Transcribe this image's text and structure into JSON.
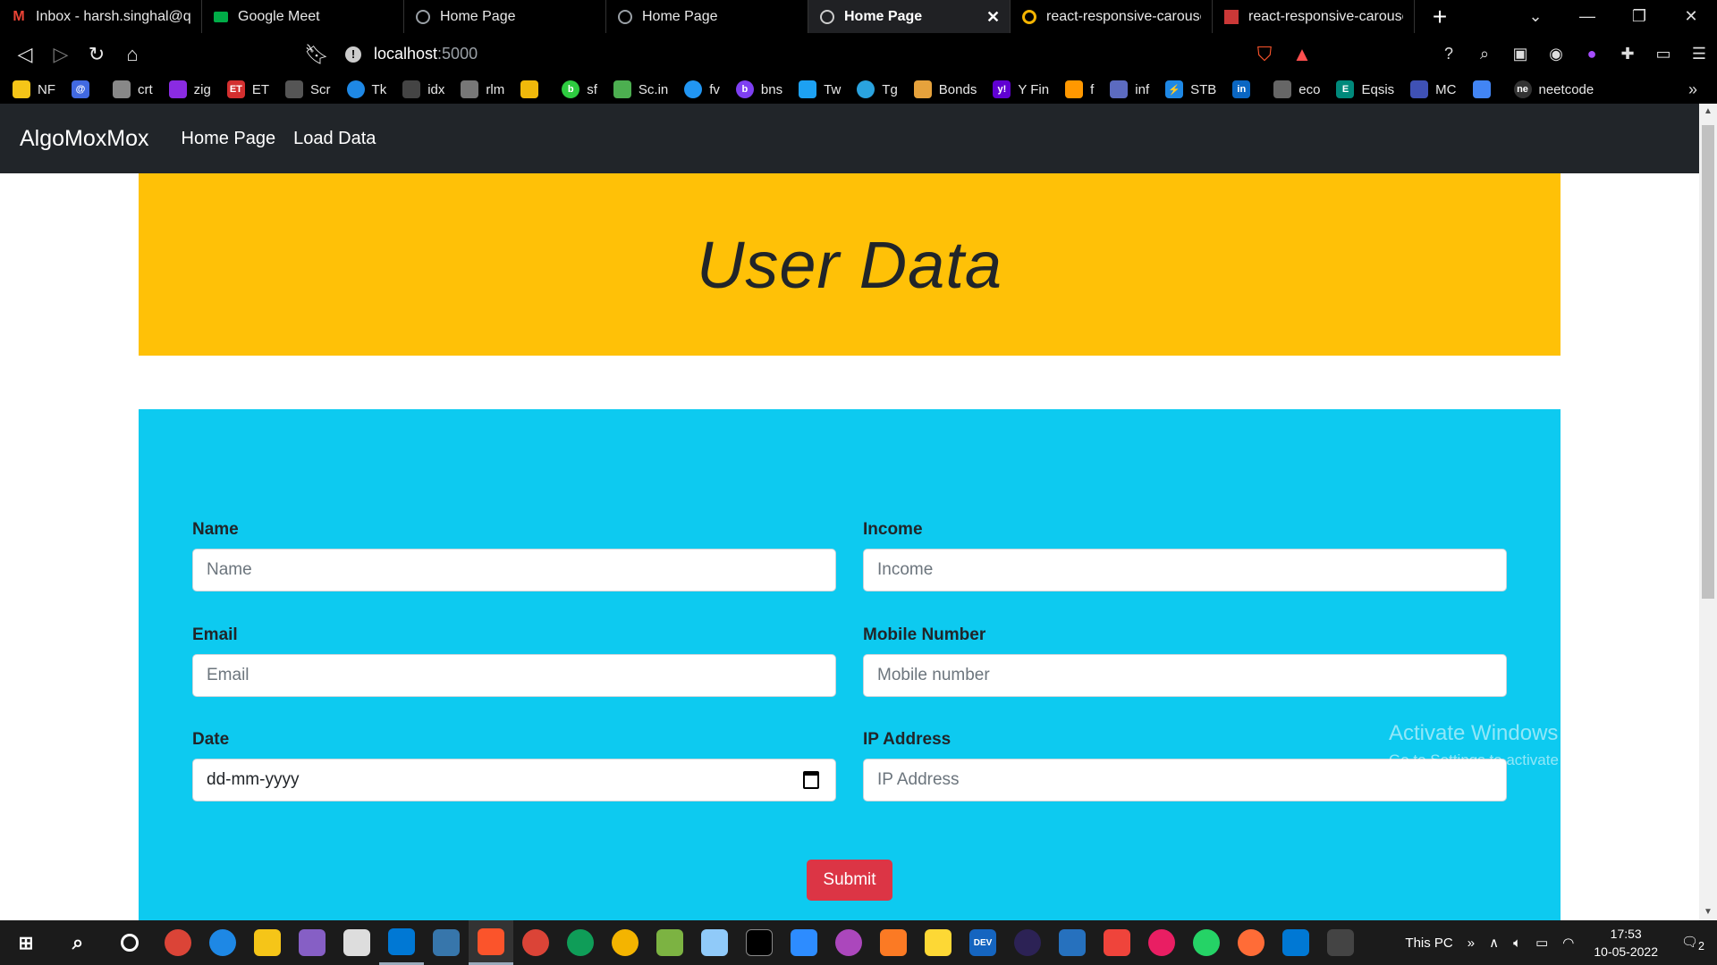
{
  "tabs": [
    {
      "label": "Inbox - harsh.singhal@qua",
      "icon": "gmail-icon",
      "color": "#ea4335",
      "active": false
    },
    {
      "label": "Google Meet",
      "icon": "meet-icon",
      "color": "#00ac47",
      "active": false
    },
    {
      "label": "Home Page",
      "icon": "globe-icon",
      "color": "#9aa0a6",
      "active": false
    },
    {
      "label": "Home Page",
      "icon": "globe-icon",
      "color": "#9aa0a6",
      "active": false
    },
    {
      "label": "Home Page",
      "icon": "globe-icon",
      "color": "#9aa0a6",
      "active": true
    },
    {
      "label": "react-responsive-carousel,",
      "icon": "ring-icon",
      "color": "#f4b400",
      "active": false
    },
    {
      "label": "react-responsive-carousel -",
      "icon": "npm-icon",
      "color": "#cb3837",
      "active": false
    }
  ],
  "address": {
    "host": "localhost",
    "port": ":5000"
  },
  "bookmarks": [
    {
      "label": "NF",
      "color": "#f5c518"
    },
    {
      "label": "",
      "color": "#4169e1"
    },
    {
      "label": "crt",
      "color": "#888888"
    },
    {
      "label": "zig",
      "color": "#8a2be2"
    },
    {
      "label": "ET",
      "color": "#d32f2f"
    },
    {
      "label": "Scr",
      "color": "#555555"
    },
    {
      "label": "Tk",
      "color": "#1e88e5"
    },
    {
      "label": "idx",
      "color": "#444444"
    },
    {
      "label": "rlm",
      "color": "#777777"
    },
    {
      "label": "",
      "color": "#f0b90b"
    },
    {
      "label": "sf",
      "color": "#2ecc40"
    },
    {
      "label": "Sc.in",
      "color": "#4caf50"
    },
    {
      "label": "fv",
      "color": "#2196f3"
    },
    {
      "label": "bns",
      "color": "#7e3ff2"
    },
    {
      "label": "Tw",
      "color": "#1da1f2"
    },
    {
      "label": "Tg",
      "color": "#2aa3df"
    },
    {
      "label": "Bonds",
      "color": "#e6a23c"
    },
    {
      "label": "Y Fin",
      "color": "#6001d2"
    },
    {
      "label": "f",
      "color": "#ff9800"
    },
    {
      "label": "inf",
      "color": "#5c6bc0"
    },
    {
      "label": "STB",
      "color": "#1e88e5"
    },
    {
      "label": "",
      "color": "#0a66c2"
    },
    {
      "label": "eco",
      "color": "#666666"
    },
    {
      "label": "Eqsis",
      "color": "#00897b"
    },
    {
      "label": "MC",
      "color": "#3f51b5"
    },
    {
      "label": "",
      "color": "#4285f4"
    },
    {
      "label": "neetcode",
      "color": "#333333"
    }
  ],
  "navbar": {
    "brand": "AlgoMoxMox",
    "links": [
      "Home Page",
      "Load Data"
    ]
  },
  "hero": {
    "title": "User Data"
  },
  "form": {
    "name": {
      "label": "Name",
      "placeholder": "Name"
    },
    "income": {
      "label": "Income",
      "placeholder": "Income"
    },
    "email": {
      "label": "Email",
      "placeholder": "Email"
    },
    "mobile": {
      "label": "Mobile Number",
      "placeholder": "Mobile number"
    },
    "date": {
      "label": "Date",
      "value": "dd-mm-yyyy"
    },
    "ip": {
      "label": "IP Address",
      "placeholder": "IP Address"
    },
    "submit_label": "Submit"
  },
  "watermark": {
    "line1": "Activate Windows",
    "line2": "Go to Settings to activate Windows."
  },
  "tray": {
    "location": "This PC",
    "time": "17:53",
    "date": "10-05-2022",
    "notifications": "2"
  },
  "colors": {
    "hero": "#ffc107",
    "form": "#0dcaf0",
    "submit": "#dc3545",
    "navbar": "#212529"
  }
}
